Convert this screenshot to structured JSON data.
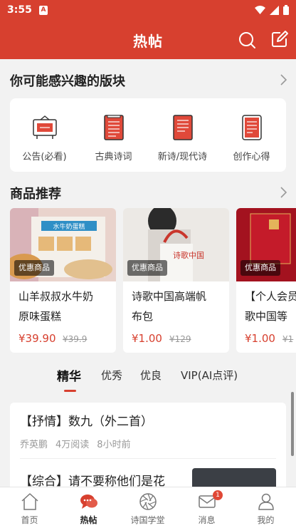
{
  "status_bar": {
    "time": "3:55",
    "a_icon": "A"
  },
  "header": {
    "title": "热帖",
    "search_icon": "search-icon",
    "edit_icon": "edit-icon"
  },
  "interest": {
    "title": "你可能感兴趣的版块",
    "items": [
      {
        "label": "公告(必看)",
        "icon": "notice-board-icon"
      },
      {
        "label": "古典诗词",
        "icon": "book-icon"
      },
      {
        "label": "新诗/现代诗",
        "icon": "book-icon"
      },
      {
        "label": "创作心得",
        "icon": "document-icon"
      }
    ]
  },
  "products": {
    "title": "商品推荐",
    "items": [
      {
        "badge": "优惠商品",
        "name": "山羊叔叔水牛奶\n原味蛋糕",
        "price": "¥39.90",
        "original_price": "¥39.9",
        "image_text": "水牛奶蛋糕"
      },
      {
        "badge": "优惠商品",
        "name": "诗歌中国高端帆\n布包",
        "price": "¥1.00",
        "original_price": "¥129",
        "image_text": "诗歌中国"
      },
      {
        "badge": "优惠商品",
        "name": "【个人会员\n歌中国等",
        "price": "¥1.00",
        "original_price": "¥1"
      }
    ]
  },
  "tabs": [
    {
      "label": "精华",
      "active": true
    },
    {
      "label": "优秀",
      "active": false
    },
    {
      "label": "优良",
      "active": false
    },
    {
      "label": "VIP(AI点评)",
      "active": false
    }
  ],
  "posts": [
    {
      "title": "【抒情】数九（外二首）",
      "author": "乔英鹏",
      "reads": "4万阅读",
      "time": "8小时前"
    },
    {
      "title": "【综合】请不要称他们是花"
    }
  ],
  "bottom_nav": [
    {
      "label": "首页",
      "icon": "home-icon",
      "active": false
    },
    {
      "label": "热帖",
      "icon": "chat-icon",
      "active": true
    },
    {
      "label": "诗国学堂",
      "icon": "aperture-icon",
      "active": false
    },
    {
      "label": "消息",
      "icon": "mail-icon",
      "active": false,
      "badge": "1"
    },
    {
      "label": "我的",
      "icon": "person-icon",
      "active": false
    }
  ],
  "colors": {
    "brand": "#d7402f",
    "background": "#f2f2f2"
  }
}
